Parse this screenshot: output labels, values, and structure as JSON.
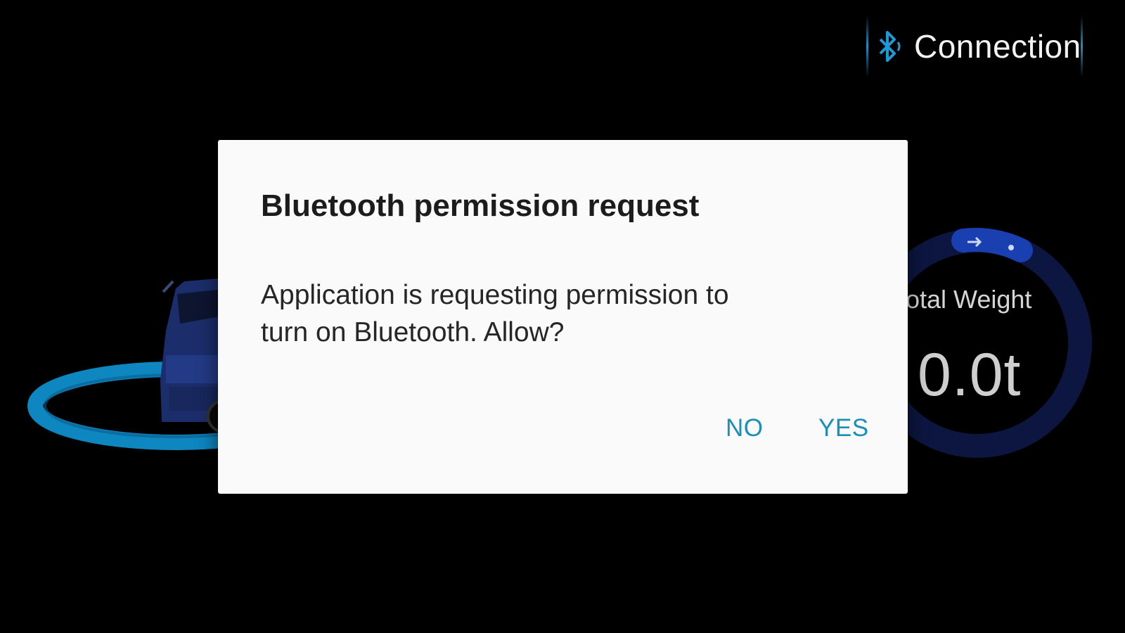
{
  "header": {
    "connection_label": "Connection",
    "connection_icon": "bluetooth-icon"
  },
  "gauge": {
    "label": "Total Weight",
    "value": "0.0t"
  },
  "dialog": {
    "title": "Bluetooth permission request",
    "message_line1": "Application is requesting permission to",
    "message_line2": "turn on Bluetooth. Allow?",
    "no_label": "NO",
    "yes_label": "YES"
  },
  "colors": {
    "accent": "#1a8fb8",
    "background": "#000000",
    "dialog_bg": "#fafafa",
    "gauge_ring": "#0c1640",
    "orbit": "#0e86c0"
  }
}
